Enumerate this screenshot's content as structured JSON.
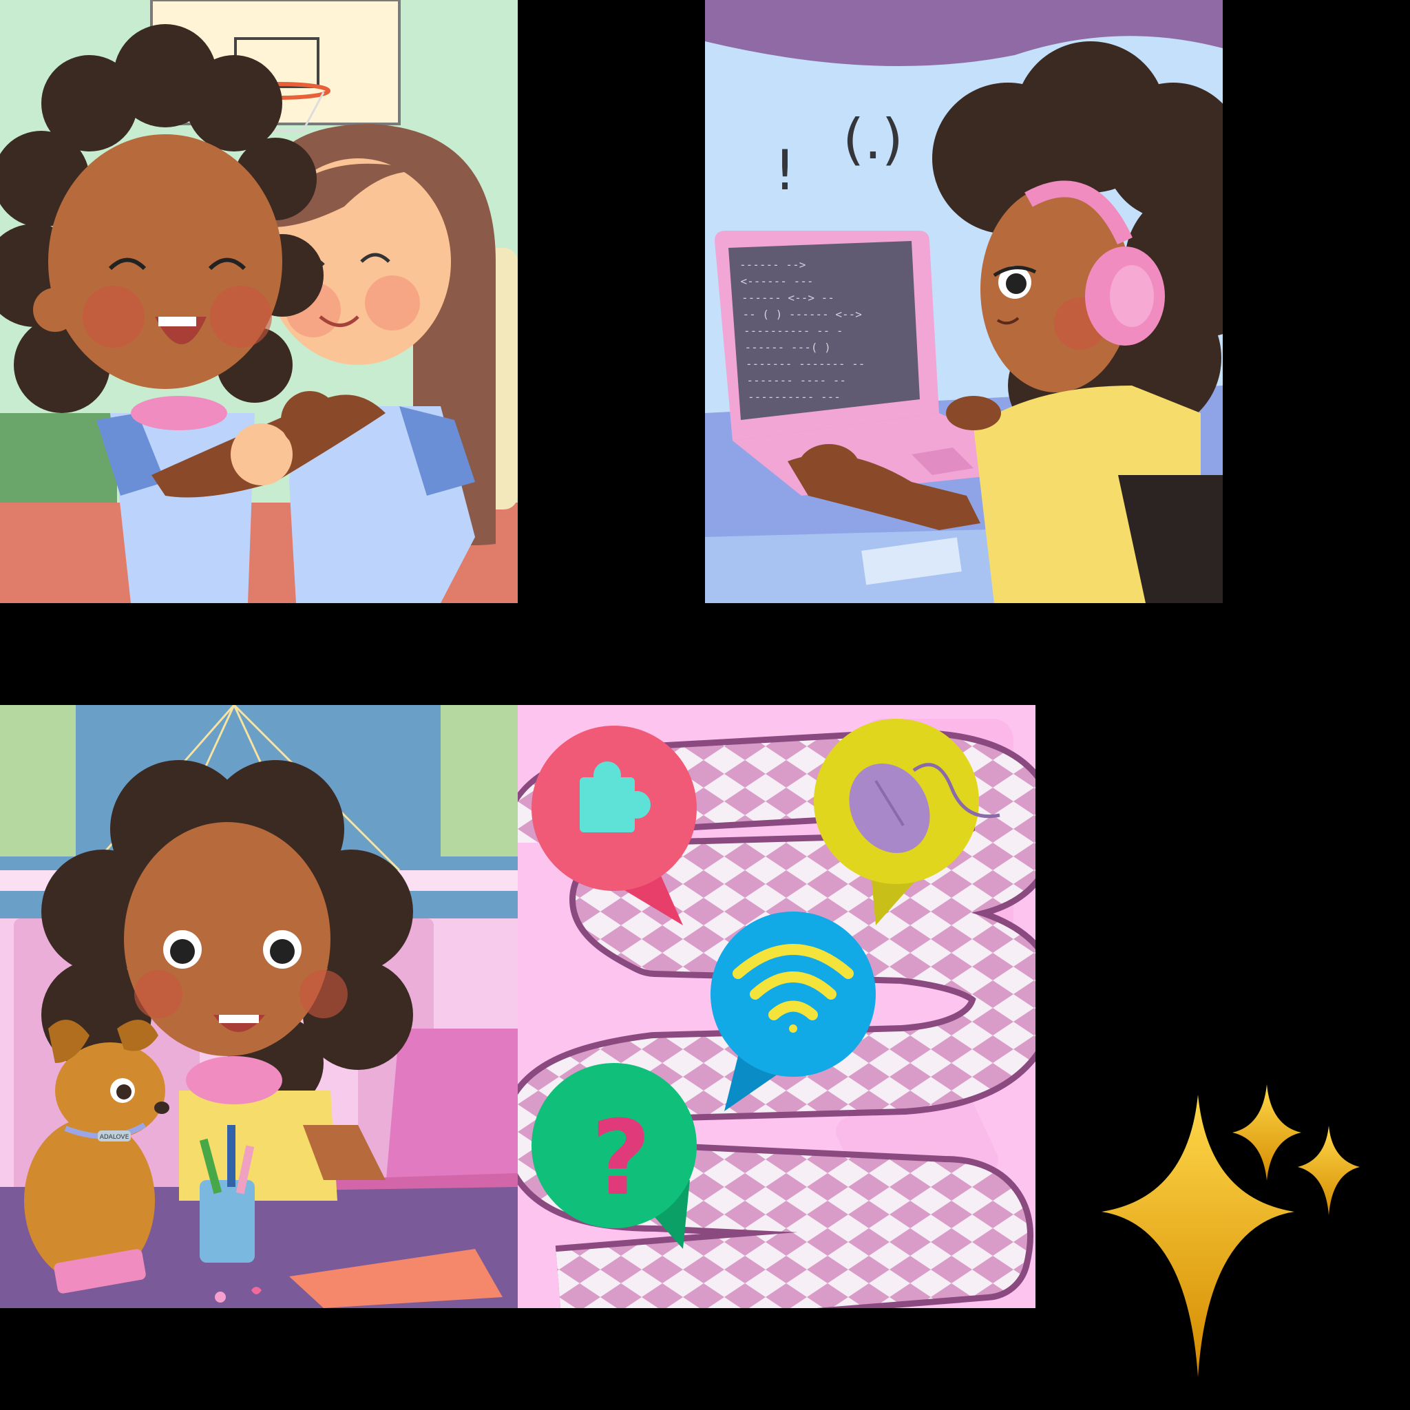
{
  "panels": {
    "coding": {
      "floating_symbols": {
        "exclamation": "!",
        "brackets": "(.)"
      },
      "code_lines": [
        "------ -->",
        "<------ ---",
        "------ <--> --",
        "-- ( ) ------ <-->",
        "---------- -- -",
        "------ ---( )",
        "------- ------- --",
        "------- ---- --",
        "---------- ---"
      ]
    },
    "path": {
      "question_mark": "?"
    },
    "desk": {
      "dog_tag": "ADALOVE"
    }
  },
  "colors": {
    "background": "#000000",
    "skin_dark": "#b76a3c",
    "hair_dark": "#3a2a22",
    "headphones": "#f08cbf",
    "laptop": "#f2a6d6",
    "puzzle_bubble": "#f05a76",
    "mouse_bubble": "#e0d61e",
    "wifi_bubble": "#11a9e6",
    "question_bubble": "#10c07a",
    "sparkle": "#f2b400"
  },
  "icons": [
    "puzzle-icon",
    "mouse-icon",
    "wifi-icon",
    "question-icon",
    "sparkle-icon"
  ]
}
